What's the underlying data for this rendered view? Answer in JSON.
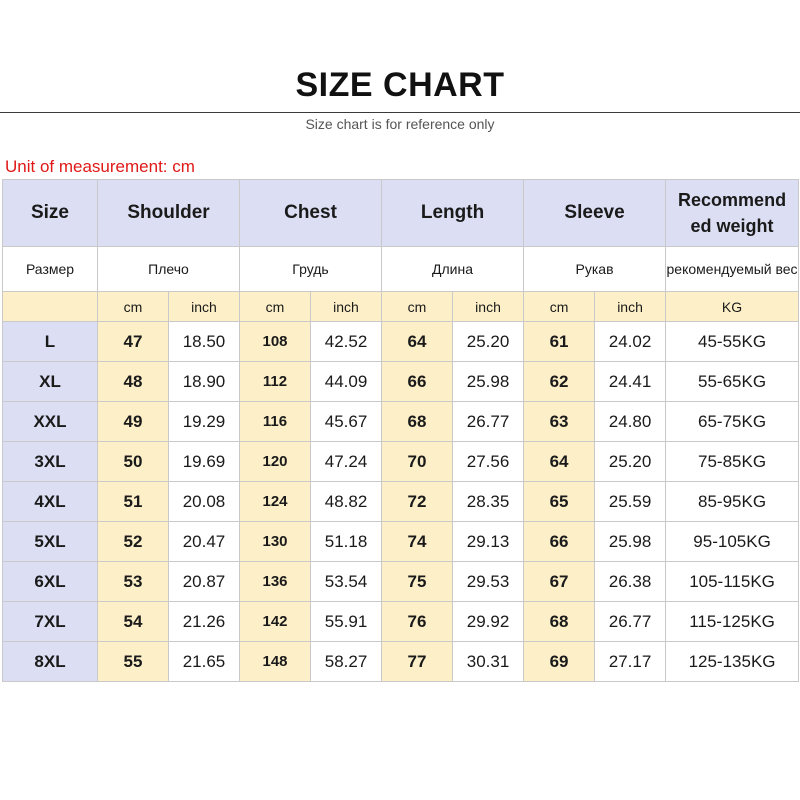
{
  "header": {
    "title": "SIZE CHART",
    "subtitle": "Size chart is for reference only",
    "unit_note": "Unit of measurement: cm"
  },
  "table": {
    "headers": {
      "size": "Size",
      "shoulder": "Shoulder",
      "chest": "Chest",
      "length": "Length",
      "sleeve": "Sleeve",
      "weight": "Recommend ed weight"
    },
    "headers_ru": {
      "size": "Размер",
      "shoulder": "Плечо",
      "chest": "Грудь",
      "length": "Длина",
      "sleeve": "Рукав",
      "weight": "рекомендуемый вес"
    },
    "units": {
      "cm": "cm",
      "inch": "inch",
      "kg": "KG"
    },
    "rows": [
      [
        "L",
        "47",
        "18.50",
        "108",
        "42.52",
        "64",
        "25.20",
        "61",
        "24.02",
        "45-55KG"
      ],
      [
        "XL",
        "48",
        "18.90",
        "112",
        "44.09",
        "66",
        "25.98",
        "62",
        "24.41",
        "55-65KG"
      ],
      [
        "XXL",
        "49",
        "19.29",
        "116",
        "45.67",
        "68",
        "26.77",
        "63",
        "24.80",
        "65-75KG"
      ],
      [
        "3XL",
        "50",
        "19.69",
        "120",
        "47.24",
        "70",
        "27.56",
        "64",
        "25.20",
        "75-85KG"
      ],
      [
        "4XL",
        "51",
        "20.08",
        "124",
        "48.82",
        "72",
        "28.35",
        "65",
        "25.59",
        "85-95KG"
      ],
      [
        "5XL",
        "52",
        "20.47",
        "130",
        "51.18",
        "74",
        "29.13",
        "66",
        "25.98",
        "95-105KG"
      ],
      [
        "6XL",
        "53",
        "20.87",
        "136",
        "53.54",
        "75",
        "29.53",
        "67",
        "26.38",
        "105-115KG"
      ],
      [
        "7XL",
        "54",
        "21.26",
        "142",
        "55.91",
        "76",
        "29.92",
        "68",
        "26.77",
        "115-125KG"
      ],
      [
        "8XL",
        "55",
        "21.65",
        "148",
        "58.27",
        "77",
        "30.31",
        "69",
        "27.17",
        "125-135KG"
      ]
    ]
  },
  "colors": {
    "header_bg": "#dcdff3",
    "cm_bg": "#fdf0c8",
    "note_red": "#e01818"
  }
}
